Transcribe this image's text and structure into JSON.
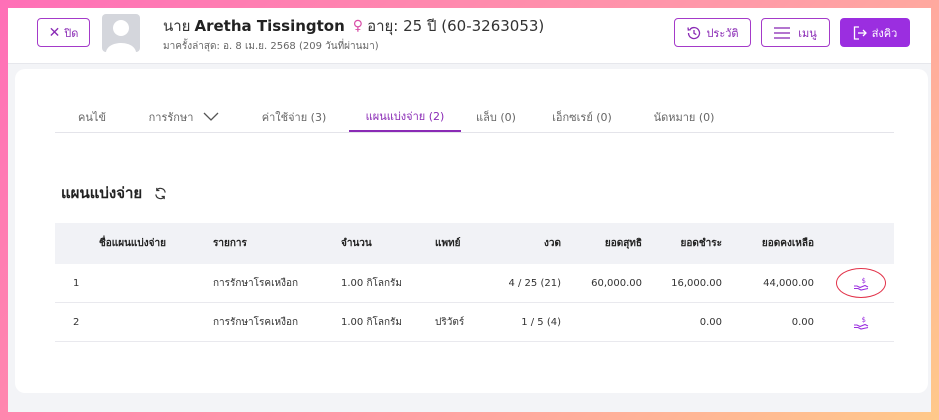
{
  "header": {
    "close_label": "ปิด",
    "patient_prefix": "นาย",
    "patient_name": "Aretha Tissington",
    "age_text": "อายุ: 25 ปี (60-3263053)",
    "last_visit": "มาครั้งล่าสุด: อ. 8 เม.ย. 2568 (209 วันที่ผ่านมา)",
    "history_label": "ประวัติ",
    "menu_label": "เมนู",
    "queue_label": "ส่งคิว",
    "gender_icon": "female-icon",
    "accent_color": "#9b2ee0"
  },
  "tabs": [
    {
      "label": "คนไข้"
    },
    {
      "label": "การรักษา"
    },
    {
      "label": "ค่าใช้จ่าย (3)"
    },
    {
      "label": "แผนแบ่งจ่าย (2)",
      "active": true
    },
    {
      "label": "แล็บ (0)"
    },
    {
      "label": "เอ็กซเรย์ (0)"
    },
    {
      "label": "นัดหมาย (0)"
    }
  ],
  "section": {
    "title": "แผนแบ่งจ่าย",
    "refresh_icon": "refresh-icon"
  },
  "table": {
    "headers": [
      "ชื่อแผนแบ่งจ่าย",
      "รายการ",
      "จำนวน",
      "แพทย์",
      "งวด",
      "ยอดสุทธิ",
      "ยอดชำระ",
      "ยอดคงเหลือ"
    ],
    "rows": [
      {
        "index": "1",
        "name": "",
        "item": "การรักษาโรคเหงือก",
        "qty": "1.00 กิโลกรัม",
        "doctor": "",
        "installment": "4 / 25 (21)",
        "net": "60,000.00",
        "paid": "16,000.00",
        "remaining": "44,000.00",
        "action_icon": "pay-hand-icon",
        "highlighted": true
      },
      {
        "index": "2",
        "name": "",
        "item": "การรักษาโรคเหงือก",
        "qty": "1.00 กิโลกรัม",
        "doctor": "ปริวัตร์",
        "installment": "1 / 5 (4)",
        "net": "",
        "paid": "0.00",
        "remaining": "0.00",
        "action_icon": "pay-hand-icon",
        "highlighted": false
      }
    ]
  }
}
